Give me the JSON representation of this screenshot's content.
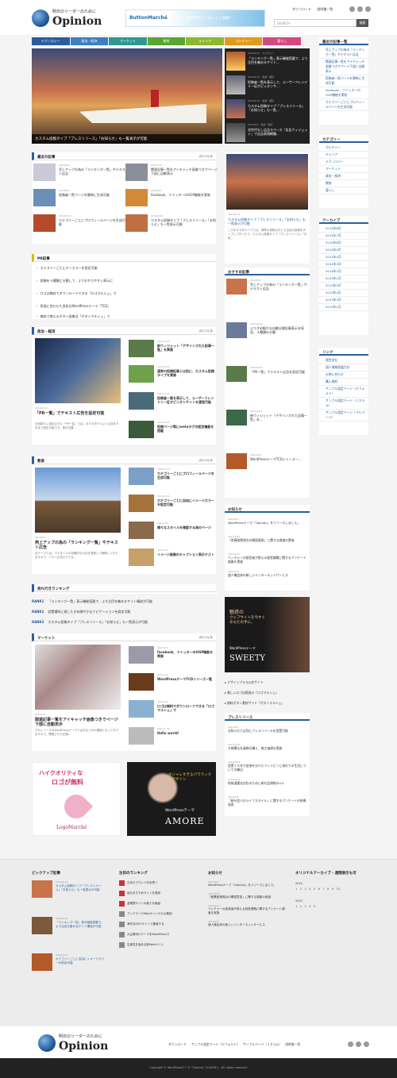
{
  "header": {
    "tagline": "明日のリーダーのために",
    "logo": "Opinion",
    "banner_brand": "ButtonMarché",
    "banner_text": "ボタン素材がダウンロードし放題！",
    "links": [
      "ダウンロード",
      "説明書一覧"
    ],
    "search_placeholder": "SEARCH",
    "search_button": "検索"
  },
  "nav": [
    {
      "label": "テクノロジー",
      "color": "#2b5d9c"
    },
    {
      "label": "政治・経済",
      "color": "#3e7fc0"
    },
    {
      "label": "マーケット",
      "color": "#2e9a8e"
    },
    {
      "label": "教育",
      "color": "#5aa52f"
    },
    {
      "label": "キャリア",
      "color": "#8cb92f"
    },
    {
      "label": "カルチャー",
      "color": "#e29a1a"
    },
    {
      "label": "暮らし",
      "color": "#d5487f"
    }
  ],
  "hero": {
    "caption": "カスタム投稿タイプ「プレスリリース」「お知らせ」も一覧表示が可能",
    "items": [
      {
        "date": "2014/4/14　カルチャー",
        "title": "「ランキング一覧」表示機能搭載で、より注目を集めるサイト..."
      },
      {
        "date": "2014/4/14　政治・経済",
        "title": "投稿者一覧を表示して、ユーザーフレンドリー征ポピュオンサ..."
      },
      {
        "date": "2014/4/14　政治・経済",
        "title": "カスタム投稿タイプ「プレスリリース」「お知らせ」も一覧..."
      },
      {
        "date": "2014/4/5　政治・経済",
        "title": "次世代なし広告スペース「広告ウィジェット」で広告表現網羅..."
      }
    ]
  },
  "latest": {
    "heading": "最近の記事",
    "more": "過去の記事",
    "items": [
      {
        "date": "2014/8/3",
        "title": "売上アップの為の「ランキング一覧」やテキスト広告"
      },
      {
        "date": "2014/7/3",
        "title": "関連記事一覧をアイキャッチ画像つきでページ下部に自動表示"
      },
      {
        "date": "2014/6/3",
        "title": "投稿者一覧ページを簡単に生成可能"
      },
      {
        "date": "2014/6/3",
        "title": "facebook、ツイッターのOGP機能を実装"
      },
      {
        "date": "2014/5/10",
        "title": "カテゴリーごとにプロフィールページを生成可能"
      },
      {
        "date": "2014/4/14",
        "title": "カスタム投稿タイプ「プレスリリース」「お知らせ」も一覧表示可能"
      }
    ]
  },
  "pr": {
    "heading": "PR記事",
    "items": [
      "カテゴリーごとにキーカラーを設定可能",
      "投稿を４種類に分類して、よりわかりやすい表示に",
      "ロゴは無料でダウンロードできる「ロゴマルシェ」で",
      "用途に合わせた多彩なWordPressテーマ「TCD」",
      "無料で使えるボタン画像は「ボタンマルシェ」で"
    ]
  },
  "econ": {
    "heading": "政治・経済",
    "more": "過去の記事",
    "big": {
      "date": "2014/4/14",
      "title": "「PR一覧」でテキスト広告を設定可能",
      "excerpt": "今回新たに追加された「PR一覧」では、おすすめテキスト広告を５本まで設定可能です。表示位置..."
    },
    "items": [
      {
        "date": "2014-4-14",
        "title": "新ウィジェット「デザインされた記事一覧」を実装"
      },
      {
        "date": "2014-4-14",
        "title": "通常の投稿記事とは別に、カスタム投稿タイプを実装"
      },
      {
        "date": "2014-4-14",
        "title": "投稿者一覧を表示して、ユーザーフレンドリー征オピニオンサイトを運営可能"
      },
      {
        "date": "2014-4-14",
        "title": "投稿ページ等にmetaタグの設定機能を搭載"
      }
    ]
  },
  "edu": {
    "heading": "教育",
    "more": "過去の記事",
    "big": {
      "date": "2014/8/3",
      "title": "売上アップの為の「ランキング一覧」やテキスト広告",
      "excerpt": "当テーマでは、マネタイズの効果的な方法を提案して稼働しておりますので、バナー広告だけでな..."
    },
    "items": [
      {
        "date": "2014-5-10",
        "title": "カテゴリーごとにプロフィールページを生成可能"
      },
      {
        "date": "2014-4-14",
        "title": "カテゴリーごとに自由にイメージカラーを設定可能"
      },
      {
        "date": "2014-3-9",
        "title": "様々なスタイルを確認する為のページ"
      },
      {
        "date": "2013-5-9",
        "title": "イメージ画像のキャプション表示テスト"
      }
    ]
  },
  "ranking": {
    "heading": "売れ行きランキング",
    "items": [
      {
        "rank": "RANK1",
        "title": "「ランキング一覧」表示機能搭載で、より注目を集めるサイト構成が可能"
      },
      {
        "rank": "RANK2",
        "title": "設置場所に適したきめ細やかなナビゲーションを設定可能"
      },
      {
        "rank": "RANK3",
        "title": "カスタム投稿タイプ「プレスリリース」「お知らせ」も一覧表示が可能"
      }
    ]
  },
  "market": {
    "heading": "マーケット",
    "more": "過去の記事",
    "big": {
      "date": "2014/7/3",
      "title": "関連記事一覧をアイキャッチ画像つきでページ下部に自動表示",
      "excerpt": "TCDシリーズのWordPressテーマではおなじみの機能となっておりますので、関連させた記事..."
    },
    "items": [
      {
        "date": "2014-6-3",
        "title": "facebook、ツイッターのOGP機能を実装"
      },
      {
        "date": "2014-4-9",
        "title": "WordPressテーマTCDシリーズ一覧"
      },
      {
        "date": "2014-2-9",
        "title": "ロゴは無料でダウンロードできる「ロゴマルシェ」で"
      },
      {
        "date": "2013-1-31",
        "title": "Hello world!"
      }
    ]
  },
  "ads": {
    "logo_line1": "ハイクオリティな",
    "logo_line2": "ロゴが無料",
    "logo_brand": "LogoMarché",
    "amore_tag": "オシャレすぎるパララックスデザイン",
    "amore_sub": "WordPressテーマ",
    "amore_name": "AMORE"
  },
  "center": {
    "feature_date": "2014/4/14",
    "feature_title": "カスタム投稿タイプ「プレスリリース」「お知らせ」も一覧表示が可能",
    "feature_excerpt": "このおすすめテーマでは、標準の投稿以外にも自由な投稿をタイプして作ったり、カスタム投稿タイプ「プレスリリース」「お知...",
    "rec_heading": "おすすめ記事",
    "rec": [
      {
        "date": "2014/8/3",
        "title": "売上アップの為の「ランキング一覧」やテキスト広告"
      },
      {
        "date": "2014/4/14",
        "title": "よりきめ細かな自動分類記事表示を採用、４種類の分類"
      },
      {
        "date": "2014/4/14",
        "title": "「PR一覧」でテキスト広告を設定可能"
      },
      {
        "date": "2014/4/14",
        "title": "新ウィジェット「デザインされた記事一覧」を..."
      },
      {
        "date": "2014/4/9",
        "title": "WordPressテーマTCDシリーズ一..."
      }
    ],
    "news_heading": "お知らせ",
    "news_more": "過去の記事",
    "news": [
      {
        "date": "2014/4/3",
        "title": "WordPressテーマ「Opinion」をリリースしました。"
      },
      {
        "date": "2014/3/22",
        "title": "「差異政策視点の開国意欲」に関する調査の実施"
      },
      {
        "date": "2014/3/11",
        "title": "ベンチャーの経営者が抱える経営課題に関するアンケート調査を実施"
      },
      {
        "date": "2014/3/8",
        "title": "速人機会体の新しいインターネットサービス"
      }
    ],
    "sweety_line1": "魅惑の",
    "sweety_line2": "ウェブサイトを今すぐあなたの手に。",
    "sweety_sub": "WordPressテーマ",
    "sweety_name": "SWEETY",
    "links": [
      "デザインプラス公式サイト",
      "美しいロゴ出現造る「ロゴマルシェ」",
      "無料ボタン素材サイト「ボタンマルシェ」"
    ],
    "press_heading": "プレスリリース",
    "press_more": "過去の記事",
    "press": [
      {
        "date": "2014/4/2",
        "title": "お知らせとは別にプレスリリースを設置可能"
      },
      {
        "date": "2014/3/30",
        "title": "大規模な社員株式構え、株主価値を実施"
      },
      {
        "date": "2014/3/24",
        "title": "設置１０年で拡張を分けたフィリピンに流れての生活についての輸出"
      },
      {
        "date": "2014/3/14",
        "title": "地球温暖化対応のために新社会規制2014"
      },
      {
        "date": "2014/3/4",
        "title": "「新社会人のライフスタイル」に関するアンケートの結果発表"
      }
    ]
  },
  "sidebar": {
    "recent_heading": "最近の記事一覧",
    "recent": [
      "売上アップの為の「ランキング一覧」やテキスト広告",
      "関連記事一覧をアイキャッチ画像つきでページ下部に自動表示",
      "投稿者一覧ページを簡単に生成可能",
      "facebook、ツイッターのOGP機能を実装",
      "カテゴリーごとにプロフィールページを生成可能"
    ],
    "cat_heading": "カテゴリー",
    "cats": [
      "カルチャー",
      "キャリア",
      "テクノロジー",
      "マーケット",
      "政治・経済",
      "教育",
      "暮らし"
    ],
    "arch_heading": "アーカイブ",
    "archives": [
      "2014年8月",
      "2014年7月",
      "2014年6月",
      "2014年5月",
      "2014年4月",
      "2014年3月",
      "2014年2月",
      "2014年1月",
      "2013年5月",
      "2013年4月",
      "2013年3月",
      "2013年1月"
    ],
    "link_heading": "リンク",
    "links": [
      "運営会社",
      "個人情報保護方針",
      "お問い合わせ",
      "購入規約",
      "サンプル固定ページ（デフォルト）",
      "サンプル固定ページ（１カラム）",
      "サンプル固定ページ（フルページ）"
    ]
  },
  "footer": {
    "pickup_heading": "ピックアップ記事",
    "pickup": [
      {
        "date": "2014/4/14",
        "title": "カスタム投稿タイプ「プレスリリース」「お知らせ」も一覧表示が可能"
      },
      {
        "date": "2014/4/14",
        "title": "「ランキング一覧」表示機能搭載で、より注目を集めるサイト構成が可能"
      },
      {
        "date": "2014/4/14",
        "title": "カテゴリーごとに自由にイメージカラーを設定可能"
      }
    ],
    "rank_heading": "注目のランキング",
    "ranks": [
      "日本のブランドを世界へ",
      "地元おすすめサイトを運用",
      "金曜発サイトの新たな取組",
      "ブックマークWebサイトからの教訓",
      "海外向けECサイトで集客する",
      "大企業向けテーマをWordPressで",
      "生産性を高める新Webサイト"
    ],
    "news_heading": "お知らせ",
    "news": [
      {
        "date": "2014/4/3",
        "title": "WordPressテーマ「Opinion」をリリースしました。"
      },
      {
        "date": "2014/3/22",
        "title": "「差異政策視点の開国意欲」に関する調査の実施"
      },
      {
        "date": "2014/3/11",
        "title": "ベンチャーの経営者が抱える経営課題に関するアンケート調査を実施"
      },
      {
        "date": "2014/3/8",
        "title": "速人機会体の新しいインターネットサービス"
      }
    ],
    "arch_heading": "オリジナルアーカイブ - 週間表示も可",
    "year1": "2014",
    "year2": "2013",
    "months1": "1　2　3　4　5　6　7　8　9　10",
    "months2": "1　2　3　4　5"
  },
  "bottom": {
    "links": [
      "ダウンロード",
      "サンプル固定ページ（デフォルト）",
      "サンプルページ（１カラム）",
      "説明書一覧"
    ],
    "copyright": "Copyright © WordPressテーマ「Opinion（tcd018）」 All rights reserved."
  }
}
